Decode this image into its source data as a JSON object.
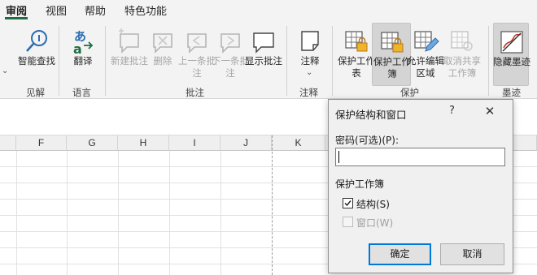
{
  "menu_tabs": [
    {
      "label": "审阅",
      "active": true
    },
    {
      "label": "视图",
      "active": false
    },
    {
      "label": "帮助",
      "active": false
    },
    {
      "label": "特色功能",
      "active": false
    }
  ],
  "ribbon": {
    "groups": {
      "insights": "见解",
      "language": "语言",
      "comments": "批注",
      "notes": "注释",
      "protect": "保护",
      "ink": "墨迹"
    },
    "buttons": {
      "smart_lookup": "智能查找",
      "translate": "翻译",
      "new_comment": "新建批注",
      "delete": "删除",
      "prev_comment": "上一条批注",
      "next_comment": "下一条批注",
      "show_comments": "显示批注",
      "notes": "注释",
      "protect_sheet": "保护工作表",
      "protect_workbook": "保护工作簿",
      "allow_edit_ranges": "允许编辑区域",
      "unshare_workbook": "取消共享工作簿",
      "hide_ink": "隐藏墨迹"
    },
    "accent_color": "#1f6e43"
  },
  "grid": {
    "columns": [
      "F",
      "G",
      "H",
      "I",
      "J",
      "K"
    ]
  },
  "dialog": {
    "title": "保护结构和窗口",
    "help": "?",
    "close": "✕",
    "password_label": "密码(可选)(P):",
    "password_value": "",
    "section_label": "保护工作簿",
    "structure_label": "结构(S)",
    "structure_checked": true,
    "windows_label": "窗口(W)",
    "windows_checked": false,
    "windows_enabled": false,
    "ok_label": "确定",
    "cancel_label": "取消"
  }
}
